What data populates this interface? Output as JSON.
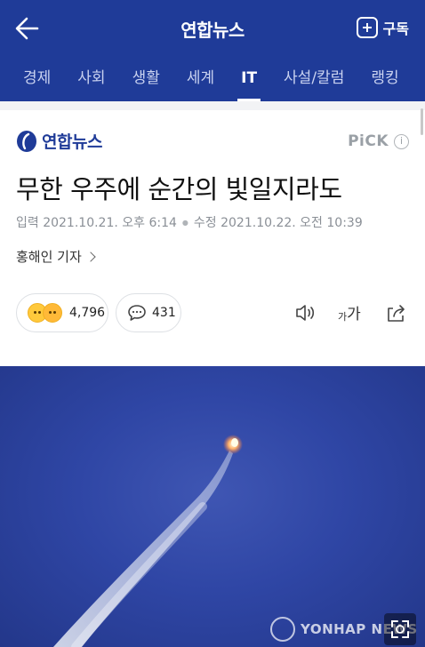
{
  "header": {
    "app_title": "연합뉴스",
    "subscribe_label": "구독"
  },
  "nav": {
    "tabs": [
      {
        "label": "경제",
        "active": false
      },
      {
        "label": "사회",
        "active": false
      },
      {
        "label": "생활",
        "active": false
      },
      {
        "label": "세계",
        "active": false
      },
      {
        "label": "IT",
        "active": true
      },
      {
        "label": "사설/칼럼",
        "active": false
      },
      {
        "label": "랭킹",
        "active": false
      }
    ]
  },
  "article": {
    "publisher": "연합뉴스",
    "pick_label": "PiCK",
    "headline": "무한 우주에 순간의 빛일지라도",
    "input_date": "입력 2021.10.21. 오후 6:14",
    "modified_date": "수정 2021.10.22. 오전 10:39",
    "reporter": "홍해인 기자",
    "reaction_count": "4,796",
    "comment_count": "431",
    "font_size_small": "가",
    "font_size_big": "가"
  },
  "photo": {
    "watermark": "YONHAP NEWS"
  },
  "colors": {
    "brand_blue": "#1f3b98",
    "sky_blue": "#2f46a5"
  }
}
